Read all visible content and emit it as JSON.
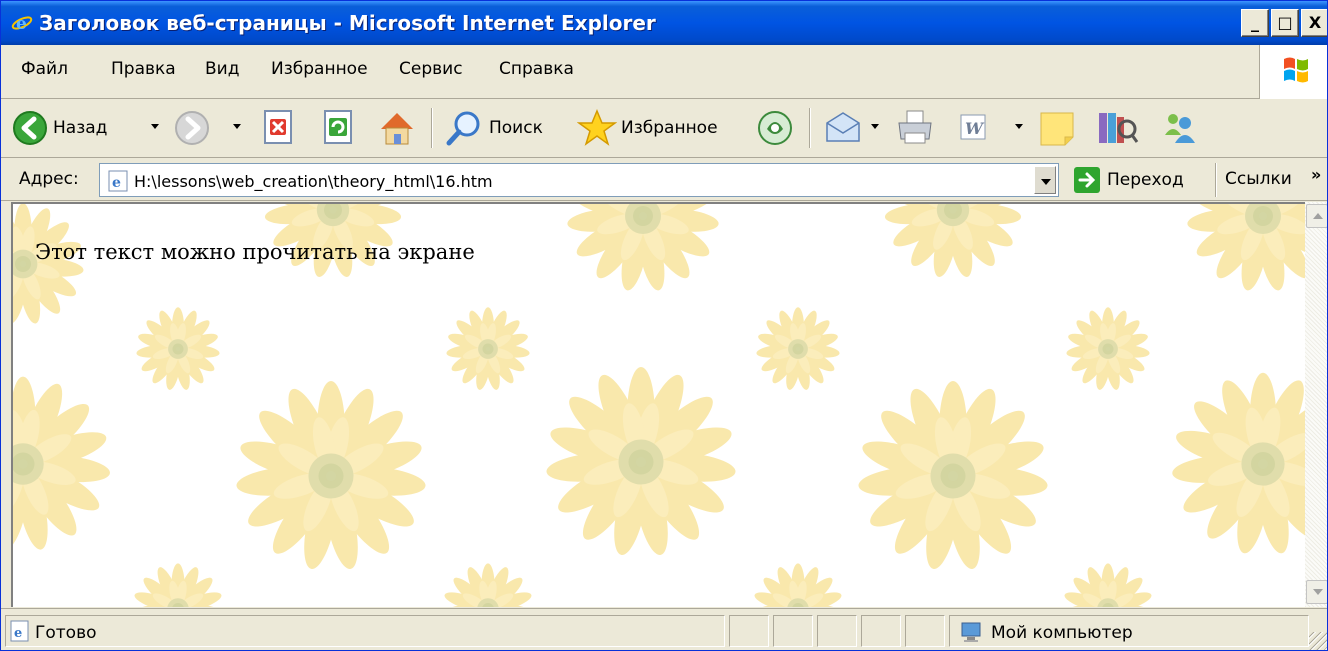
{
  "window": {
    "title": "Заголовок веб-страницы - Microsoft Internet Explorer",
    "controls": [
      "_",
      "□",
      "X"
    ]
  },
  "menu": {
    "items": [
      "Файл",
      "Правка",
      "Вид",
      "Избранное",
      "Сервис",
      "Справка"
    ]
  },
  "toolbar": {
    "back_label": "Назад",
    "search_label": "Поиск",
    "favorites_label": "Избранное"
  },
  "address": {
    "label": "Адрес:",
    "value": "H:\\lessons\\web_creation\\theory_html\\16.htm",
    "go_label": "Переход",
    "links_label": "Ссылки",
    "chevron": "»"
  },
  "page": {
    "text": "Этот текст можно прочитать на экране"
  },
  "status": {
    "text": "Готово",
    "zone": "Мой компьютер"
  },
  "colors": {
    "titlebar": "#0054e3",
    "chrome": "#ece9d8",
    "flower": "#f5d66b"
  }
}
